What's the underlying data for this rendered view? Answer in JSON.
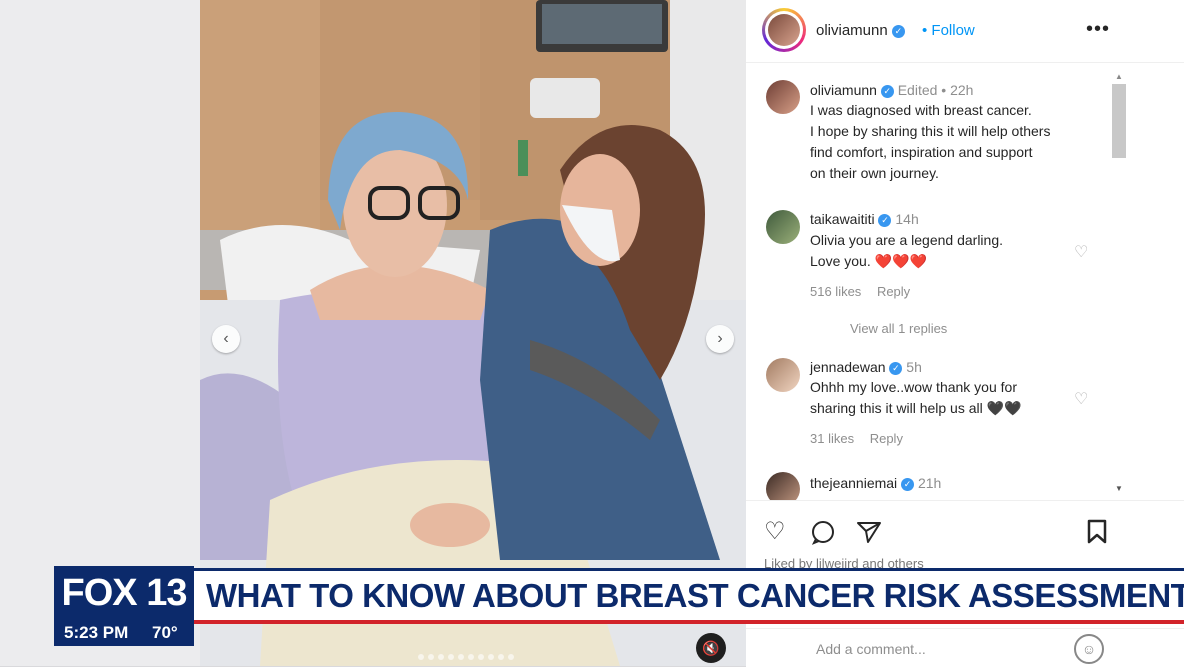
{
  "post": {
    "username": "oliviamunn",
    "follow_label": "Follow",
    "more_label": "•••",
    "caption_meta": "Edited • 22h",
    "caption_lines": [
      "I was diagnosed with breast cancer.",
      "I hope by sharing this it will help others",
      "find comfort, inspiration and support",
      "on their own journey."
    ]
  },
  "comments": [
    {
      "username": "taikawaititi",
      "time": "14h",
      "lines": [
        "Olivia you are a legend darling.",
        "Love you. ❤️❤️❤️"
      ],
      "likes": "516 likes",
      "reply": "Reply",
      "view_replies": "View all 1 replies"
    },
    {
      "username": "jennadewan",
      "time": "5h",
      "lines": [
        "Ohhh my love..wow thank you for",
        "sharing this it will help us all 🖤🖤"
      ],
      "likes": "31 likes",
      "reply": "Reply"
    },
    {
      "username": "thejeanniemai",
      "time": "21h"
    }
  ],
  "actions": {
    "liked_by": "Liked by lilweijrd and others",
    "add_comment_placeholder": "Add a comment..."
  },
  "broadcast": {
    "logo": "FOX 13",
    "headline": "WHAT TO KNOW ABOUT BREAST CANCER RISK ASSESSMENTS",
    "time": "5:23 PM",
    "temperature": "70°"
  },
  "colors": {
    "fox_navy": "#0c2a6b",
    "fox_red": "#d2232a",
    "ig_blue": "#0095f6",
    "verified": "#3897f0"
  },
  "icons": [
    "chevron-left-icon",
    "chevron-right-icon",
    "mute-icon",
    "heart-icon",
    "comment-icon",
    "share-icon",
    "bookmark-icon",
    "emoji-icon",
    "verified-icon"
  ]
}
